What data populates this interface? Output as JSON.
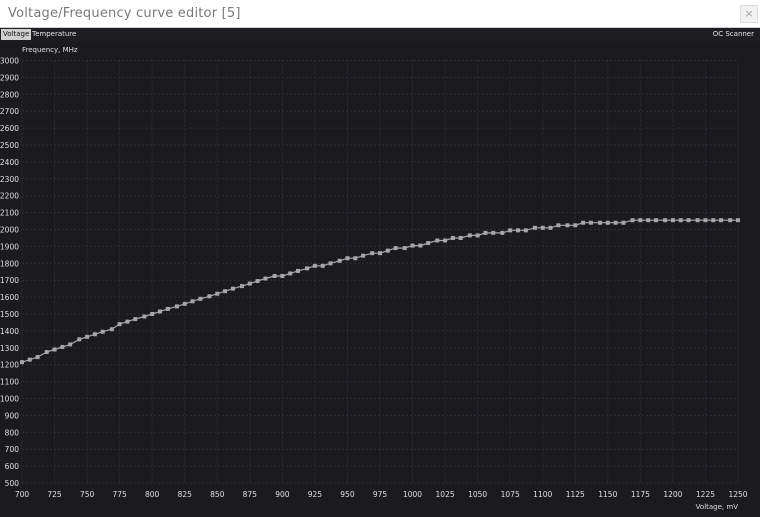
{
  "window": {
    "title": "Voltage/Frequency curve editor [5]",
    "close_glyph": "×"
  },
  "tabs": [
    {
      "label": "Voltage",
      "active": true
    },
    {
      "label": "Temperature",
      "active": false
    }
  ],
  "oc_scanner_label": "OC Scanner",
  "colors": {
    "background": "#1b1a1f",
    "grid": "#2f2e34",
    "axis_text": "#e0e0e0",
    "curve": "#a7a7ab",
    "point": "#a7a7ab"
  },
  "chart_data": {
    "type": "line",
    "ylabel": "Frequency, MHz",
    "xlabel": "Voltage, mV",
    "xlim": [
      700,
      1250
    ],
    "ylim": [
      500,
      3000
    ],
    "xticks": [
      700,
      725,
      750,
      775,
      800,
      825,
      850,
      875,
      900,
      925,
      950,
      975,
      1000,
      1025,
      1050,
      1075,
      1100,
      1125,
      1150,
      1175,
      1200,
      1225,
      1250
    ],
    "yticks": [
      500,
      600,
      700,
      800,
      900,
      1000,
      1100,
      1200,
      1300,
      1400,
      1500,
      1600,
      1700,
      1800,
      1900,
      2000,
      2100,
      2200,
      2300,
      2400,
      2500,
      2600,
      2700,
      2800,
      2900,
      3000
    ],
    "grid": true,
    "series": [
      {
        "x": [
          700,
          706,
          712,
          719,
          725,
          731,
          737,
          744,
          750,
          756,
          762,
          769,
          775,
          781,
          787,
          794,
          800,
          806,
          812,
          819,
          825,
          831,
          837,
          844,
          850,
          856,
          862,
          869,
          875,
          881,
          887,
          894,
          900,
          906,
          912,
          919,
          925,
          931,
          937,
          944,
          950,
          956,
          962,
          969,
          975,
          981,
          987,
          994,
          1000,
          1006,
          1012,
          1019,
          1025,
          1031,
          1037,
          1044,
          1050,
          1056,
          1062,
          1069,
          1075,
          1081,
          1087,
          1094,
          1100,
          1106,
          1112,
          1119,
          1125,
          1131,
          1137,
          1144,
          1150,
          1156,
          1162,
          1169,
          1175,
          1181,
          1187,
          1194,
          1200,
          1206,
          1212,
          1219,
          1225,
          1231,
          1237,
          1244,
          1250
        ],
        "y": [
          1215,
          1230,
          1245,
          1275,
          1290,
          1305,
          1320,
          1350,
          1365,
          1380,
          1395,
          1410,
          1440,
          1455,
          1470,
          1485,
          1500,
          1515,
          1530,
          1545,
          1560,
          1575,
          1590,
          1605,
          1620,
          1635,
          1650,
          1665,
          1680,
          1695,
          1710,
          1725,
          1725,
          1740,
          1755,
          1770,
          1785,
          1785,
          1800,
          1815,
          1830,
          1830,
          1845,
          1860,
          1860,
          1875,
          1890,
          1890,
          1905,
          1905,
          1920,
          1935,
          1935,
          1950,
          1950,
          1965,
          1965,
          1980,
          1980,
          1980,
          1995,
          1995,
          1995,
          2010,
          2010,
          2010,
          2025,
          2025,
          2025,
          2040,
          2040,
          2040,
          2040,
          2040,
          2040,
          2055,
          2055,
          2055,
          2055,
          2055,
          2055,
          2055,
          2055,
          2055,
          2055,
          2055,
          2055,
          2055,
          2055
        ]
      }
    ]
  }
}
